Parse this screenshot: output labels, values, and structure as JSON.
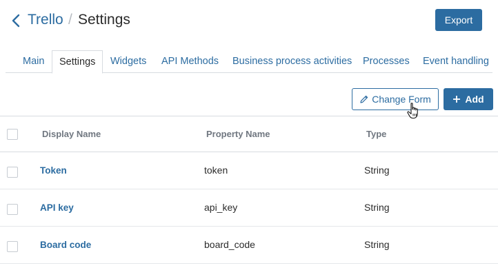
{
  "header": {
    "breadcrumb_app": "Trello",
    "breadcrumb_separator": "/",
    "page_title": "Settings",
    "export_label": "Export"
  },
  "tabs": [
    {
      "label": "Main",
      "active": false
    },
    {
      "label": "Settings",
      "active": true
    },
    {
      "label": "Widgets",
      "active": false
    },
    {
      "label": "API Methods",
      "active": false
    },
    {
      "label": "Business process activities",
      "active": false
    },
    {
      "label": "Processes",
      "active": false
    },
    {
      "label": "Event handling",
      "active": false
    }
  ],
  "toolbar": {
    "change_form_label": "Change Form",
    "add_label": "Add"
  },
  "table": {
    "columns": [
      "Display Name",
      "Property Name",
      "Type"
    ],
    "rows": [
      {
        "display_name": "Token",
        "property_name": "token",
        "type": "String"
      },
      {
        "display_name": "API key",
        "property_name": "api_key",
        "type": "String"
      },
      {
        "display_name": "Board code",
        "property_name": "board_code",
        "type": "String"
      }
    ]
  },
  "colors": {
    "accent": "#2c6ca1",
    "border": "#d7dbe0",
    "header_text": "#707780"
  },
  "icons": {
    "back": "chevron-left-icon",
    "edit": "pencil-icon",
    "add": "plus-icon",
    "cursor": "hand-pointer-icon"
  }
}
